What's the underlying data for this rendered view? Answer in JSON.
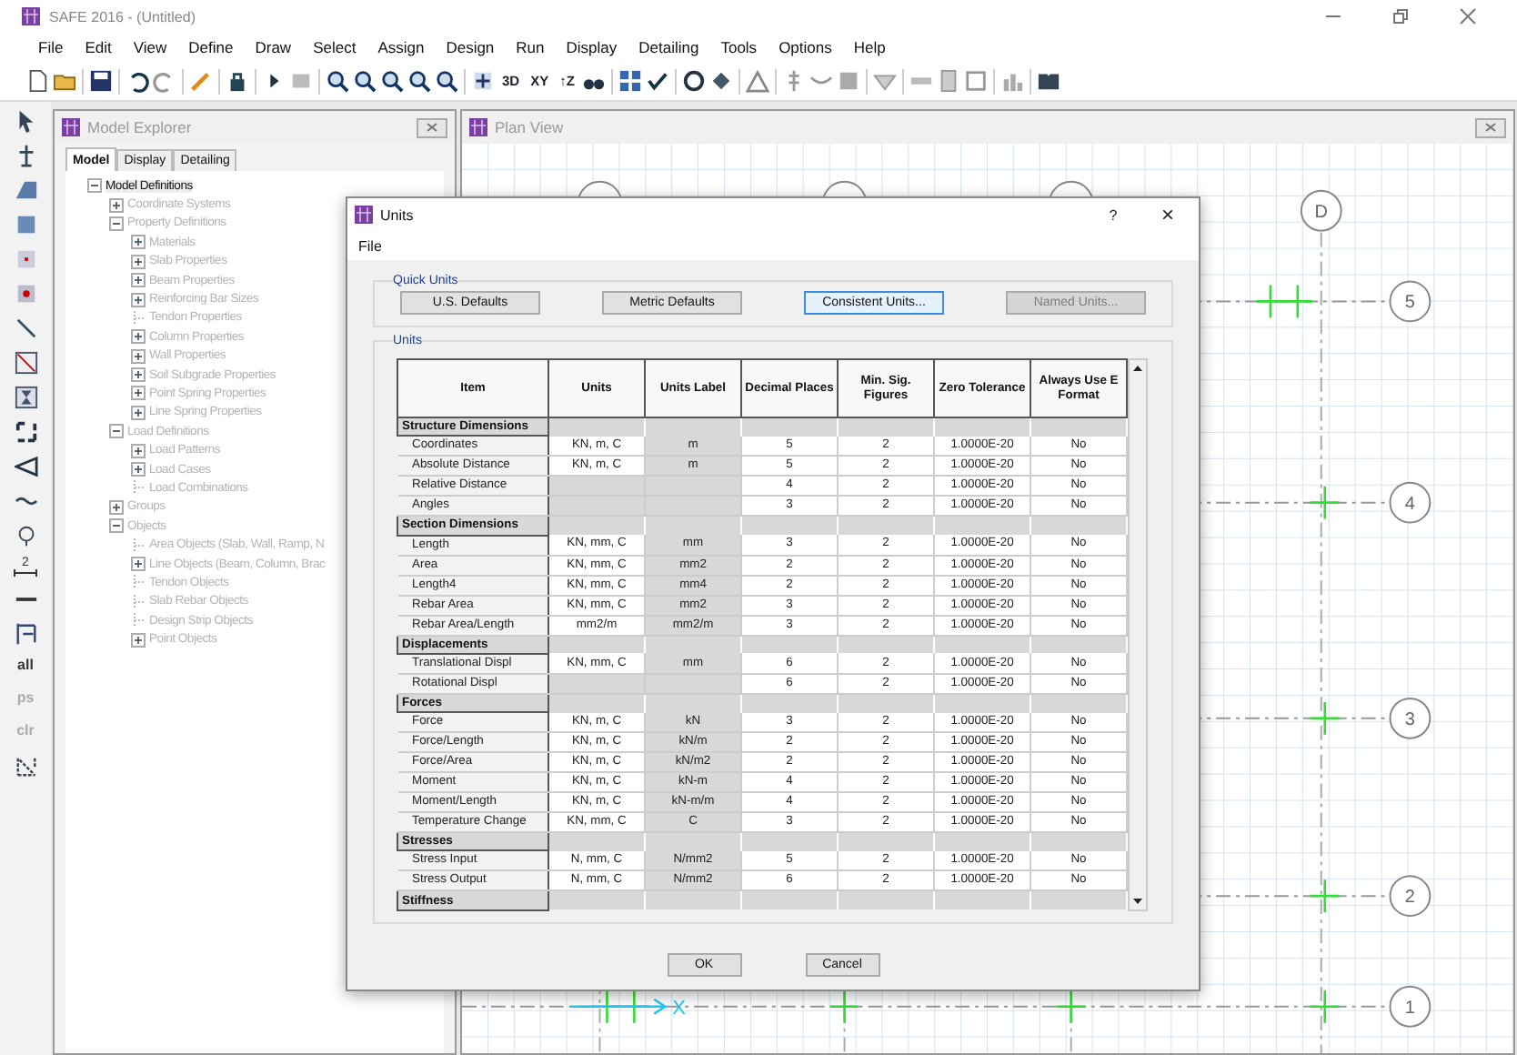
{
  "window": {
    "title": "SAFE 2016 - (Untitled)"
  },
  "menu": [
    "File",
    "Edit",
    "View",
    "Define",
    "Draw",
    "Select",
    "Assign",
    "Design",
    "Run",
    "Display",
    "Detailing",
    "Tools",
    "Options",
    "Help"
  ],
  "toolbar": {
    "text_buttons": [
      "3D",
      "XY",
      "↑Z"
    ]
  },
  "left_toolbar": {
    "dimension_label": "2",
    "text_buttons": [
      {
        "label": "all",
        "disabled": false
      },
      {
        "label": "ps",
        "disabled": true
      },
      {
        "label": "clr",
        "disabled": true
      }
    ]
  },
  "model_explorer": {
    "title": "Model Explorer",
    "tabs": [
      {
        "label": "Model",
        "selected": true
      },
      {
        "label": "Display",
        "selected": false
      },
      {
        "label": "Detailing",
        "selected": false
      }
    ],
    "tree": [
      {
        "label": "Model Definitions",
        "expanded": true,
        "selected": true,
        "children": [
          {
            "label": "Coordinate Systems",
            "expanded": false,
            "selected": false
          },
          {
            "label": "Property Definitions",
            "expanded": true,
            "selected": false,
            "children": [
              {
                "label": "Materials",
                "expanded": false,
                "selected": false
              },
              {
                "label": "Slab Properties",
                "expanded": false,
                "selected": false
              },
              {
                "label": "Beam Properties",
                "expanded": false,
                "selected": false
              },
              {
                "label": "Reinforcing Bar Sizes",
                "expanded": false,
                "selected": false
              },
              {
                "label": "Tendon Properties",
                "selected": false
              },
              {
                "label": "Column Properties",
                "expanded": false,
                "selected": false
              },
              {
                "label": "Wall Properties",
                "expanded": false,
                "selected": false
              },
              {
                "label": "Soil Subgrade Properties",
                "expanded": false,
                "selected": false
              },
              {
                "label": "Point Spring Properties",
                "expanded": false,
                "selected": false
              },
              {
                "label": "Line Spring Properties",
                "expanded": false,
                "selected": false
              }
            ]
          },
          {
            "label": "Load Definitions",
            "expanded": true,
            "selected": false,
            "children": [
              {
                "label": "Load Patterns",
                "expanded": false,
                "selected": false
              },
              {
                "label": "Load Cases",
                "expanded": false,
                "selected": false
              },
              {
                "label": "Load Combinations",
                "selected": false
              }
            ]
          },
          {
            "label": "Groups",
            "expanded": false,
            "selected": false
          },
          {
            "label": "Objects",
            "expanded": true,
            "selected": false,
            "children": [
              {
                "label": "Area Objects (Slab, Wall, Ramp, N",
                "selected": false
              },
              {
                "label": "Line Objects (Beam, Column, Brac",
                "expanded": false,
                "selected": false
              },
              {
                "label": "Tendon Objects",
                "selected": false
              },
              {
                "label": "Slab Rebar Objects",
                "selected": false
              },
              {
                "label": "Design Strip Objects",
                "selected": false
              },
              {
                "label": "Point Objects",
                "expanded": false,
                "selected": false
              }
            ]
          }
        ]
      }
    ]
  },
  "plan_view": {
    "title": "Plan View",
    "grid_bubbles": [
      "D",
      "5",
      "4",
      "3",
      "2",
      "1"
    ],
    "axis_label": "X"
  },
  "dialog": {
    "title": "Units",
    "help": "?",
    "close": "×",
    "menu": [
      "File"
    ],
    "quick_units": {
      "title": "Quick Units",
      "buttons": [
        {
          "label": "U.S. Defaults",
          "disabled": false,
          "focused": false
        },
        {
          "label": "Metric Defaults",
          "disabled": false,
          "focused": false
        },
        {
          "label": "Consistent Units...",
          "disabled": false,
          "focused": true
        },
        {
          "label": "Named Units...",
          "disabled": true,
          "focused": false
        }
      ]
    },
    "units": {
      "title": "Units",
      "columns": [
        "Item",
        "Units",
        "Units Label",
        "Decimal Places",
        "Min. Sig. Figures",
        "Zero Tolerance",
        "Always Use E Format"
      ],
      "rows": [
        {
          "kind": "group",
          "label": "Structure Dimensions"
        },
        {
          "kind": "item",
          "cells": [
            "Coordinates",
            "KN, m, C",
            "m",
            "5",
            "2",
            "1.0000E-20",
            "No"
          ]
        },
        {
          "kind": "item",
          "cells": [
            "Absolute Distance",
            "KN, m, C",
            "m",
            "5",
            "2",
            "1.0000E-20",
            "No"
          ]
        },
        {
          "kind": "item",
          "cells": [
            "Relative Distance",
            null,
            null,
            "4",
            "2",
            "1.0000E-20",
            "No"
          ]
        },
        {
          "kind": "item",
          "cells": [
            "Angles",
            null,
            null,
            "3",
            "2",
            "1.0000E-20",
            "No"
          ]
        },
        {
          "kind": "group",
          "label": "Section Dimensions"
        },
        {
          "kind": "item",
          "cells": [
            "Length",
            "KN, mm, C",
            "mm",
            "3",
            "2",
            "1.0000E-20",
            "No"
          ]
        },
        {
          "kind": "item",
          "cells": [
            "Area",
            "KN, mm, C",
            "mm2",
            "2",
            "2",
            "1.0000E-20",
            "No"
          ]
        },
        {
          "kind": "item",
          "cells": [
            "Length4",
            "KN, mm, C",
            "mm4",
            "2",
            "2",
            "1.0000E-20",
            "No"
          ]
        },
        {
          "kind": "item",
          "cells": [
            "Rebar Area",
            "KN, mm, C",
            "mm2",
            "3",
            "2",
            "1.0000E-20",
            "No"
          ]
        },
        {
          "kind": "item",
          "cells": [
            "Rebar Area/Length",
            "mm2/m",
            "mm2/m",
            "3",
            "2",
            "1.0000E-20",
            "No"
          ]
        },
        {
          "kind": "group",
          "label": "Displacements"
        },
        {
          "kind": "item",
          "cells": [
            "Translational Displ",
            "KN, mm, C",
            "mm",
            "6",
            "2",
            "1.0000E-20",
            "No"
          ]
        },
        {
          "kind": "item",
          "cells": [
            "Rotational Displ",
            null,
            null,
            "6",
            "2",
            "1.0000E-20",
            "No"
          ]
        },
        {
          "kind": "group",
          "label": "Forces"
        },
        {
          "kind": "item",
          "cells": [
            "Force",
            "KN, m, C",
            "kN",
            "3",
            "2",
            "1.0000E-20",
            "No"
          ]
        },
        {
          "kind": "item",
          "cells": [
            "Force/Length",
            "KN, m, C",
            "kN/m",
            "2",
            "2",
            "1.0000E-20",
            "No"
          ]
        },
        {
          "kind": "item",
          "cells": [
            "Force/Area",
            "KN, m, C",
            "kN/m2",
            "2",
            "2",
            "1.0000E-20",
            "No"
          ]
        },
        {
          "kind": "item",
          "cells": [
            "Moment",
            "KN, m, C",
            "kN-m",
            "4",
            "2",
            "1.0000E-20",
            "No"
          ]
        },
        {
          "kind": "item",
          "cells": [
            "Moment/Length",
            "KN, m, C",
            "kN-m/m",
            "4",
            "2",
            "1.0000E-20",
            "No"
          ]
        },
        {
          "kind": "item",
          "cells": [
            "Temperature Change",
            "KN, mm, C",
            "C",
            "3",
            "2",
            "1.0000E-20",
            "No"
          ]
        },
        {
          "kind": "group",
          "label": "Stresses"
        },
        {
          "kind": "item",
          "cells": [
            "Stress Input",
            "N, mm, C",
            "N/mm2",
            "5",
            "2",
            "1.0000E-20",
            "No"
          ]
        },
        {
          "kind": "item",
          "cells": [
            "Stress Output",
            "N, mm, C",
            "N/mm2",
            "6",
            "2",
            "1.0000E-20",
            "No"
          ]
        },
        {
          "kind": "group",
          "label": "Stiffness"
        }
      ]
    },
    "buttons": [
      "OK",
      "Cancel"
    ]
  }
}
